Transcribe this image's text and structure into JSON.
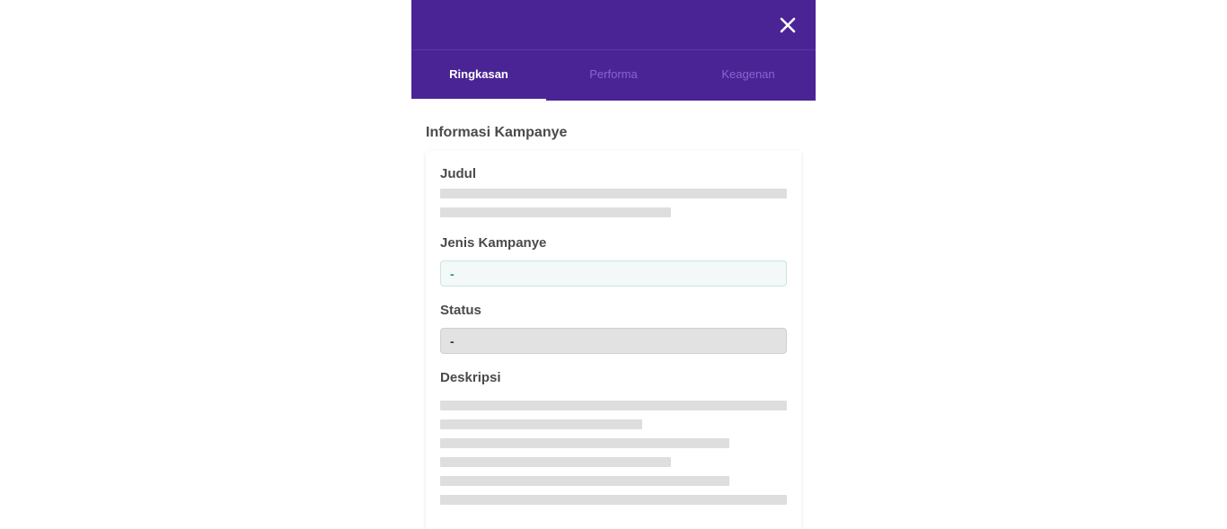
{
  "header": {
    "close_icon": "close-icon"
  },
  "tabs": [
    {
      "label": "Ringkasan",
      "active": true
    },
    {
      "label": "Performa",
      "active": false
    },
    {
      "label": "Keagenan",
      "active": false
    }
  ],
  "section": {
    "title": "Informasi Kampanye"
  },
  "fields": {
    "title_label": "Judul",
    "type_label": "Jenis Kampanye",
    "type_value": "-",
    "status_label": "Status",
    "status_value": "-",
    "description_label": "Deskripsi"
  },
  "colors": {
    "header_bg": "#4a2494",
    "tab_active": "#ffffff",
    "tab_inactive": "#8a64cf",
    "type_value_text": "#2c8f86",
    "skeleton": "#dedede"
  }
}
